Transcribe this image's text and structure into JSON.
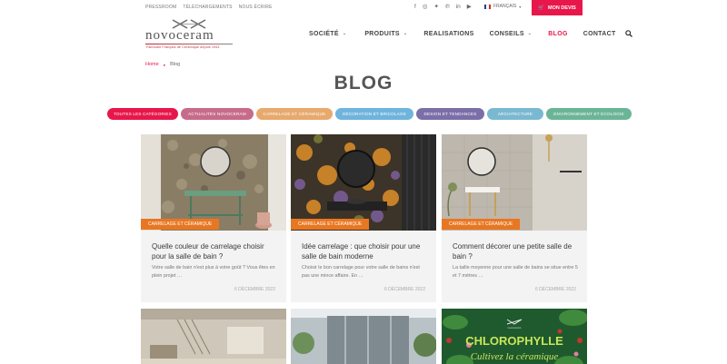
{
  "topbar": {
    "links": [
      "PRESSROOM",
      "TÉLÉCHARGEMENTS",
      "NOUS ÉCRIRE"
    ],
    "socials": [
      "facebook-icon",
      "instagram-icon",
      "twitter-icon",
      "pinterest-icon",
      "linkedin-icon",
      "youtube-icon"
    ],
    "language": "FRANÇAIS",
    "quote_button": "MON DEVIS"
  },
  "header": {
    "logo_text": "novoceram",
    "logo_tagline": "Fabricant Français de Céramique depuis 1943",
    "nav": [
      {
        "label": "SOCIÉTÉ",
        "dropdown": true
      },
      {
        "label": "PRODUITS",
        "dropdown": true
      },
      {
        "label": "REALISATIONS",
        "dropdown": false
      },
      {
        "label": "CONSEILS",
        "dropdown": true
      },
      {
        "label": "BLOG",
        "dropdown": false,
        "active": true
      },
      {
        "label": "CONTACT",
        "dropdown": false
      }
    ]
  },
  "breadcrumb": {
    "home": "Home",
    "current": "Blog"
  },
  "page_title": "BLOG",
  "categories": [
    {
      "label": "TOUTES LES CATÉGORIES",
      "color": "#e8174b"
    },
    {
      "label": "ACTUALITÉS NOVOCERAM",
      "color": "#c76b8a"
    },
    {
      "label": "CARRELAGE ET CÉRAMIQUE",
      "color": "#e8a96d"
    },
    {
      "label": "DÉCORATION ET BRICOLAGE",
      "color": "#6fb4dd"
    },
    {
      "label": "DESIGN ET TENDANCES",
      "color": "#7b6fa8"
    },
    {
      "label": "ARCHITECTURE",
      "color": "#7ab8d1"
    },
    {
      "label": "ENVIRONNEMENT ET ÉCOLOGIE",
      "color": "#6bb597"
    }
  ],
  "posts": [
    {
      "tag": "CARRELAGE ET CÉRAMIQUE",
      "title": "Quelle couleur de carrelage choisir pour la salle de bain ?",
      "excerpt": "Votre salle de bain n'est plus à votre goût ? Vous êtes en plein projet …",
      "date": "6 DÉCEMBRE 2022"
    },
    {
      "tag": "CARRELAGE ET CÉRAMIQUE",
      "title": "Idée carrelage : que choisir pour une salle de bain moderne",
      "excerpt": "Choisir le bon carrelage pour votre salle de bains n'est pas une mince affaire. En …",
      "date": "6 DÉCEMBRE 2022"
    },
    {
      "tag": "CARRELAGE ET CÉRAMIQUE",
      "title": "Comment décorer une petite salle de bain ?",
      "excerpt": "La taille moyenne pour une salle de bains se situe entre 5 et 7 mètres …",
      "date": "6 DÉCEMBRE 2022"
    }
  ],
  "promo": {
    "title": "CHLOROPHYLLE",
    "subtitle": "Cultivez la céramique"
  },
  "colors": {
    "accent": "#e8174b",
    "tag": "#e87722"
  }
}
